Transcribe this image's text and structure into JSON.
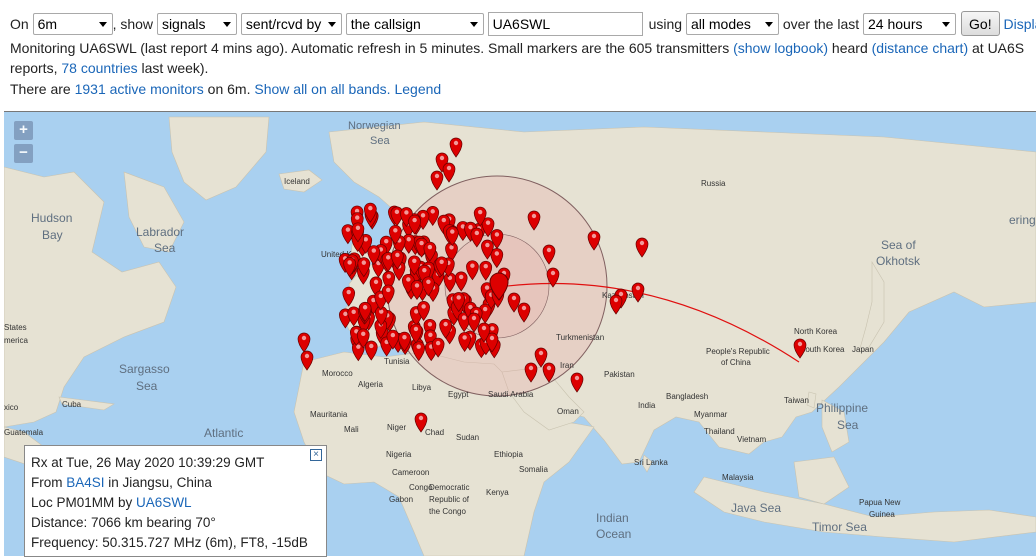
{
  "controls": {
    "on_label": "On",
    "band_value": "6m",
    "show_label": ", show",
    "show_value": "signals",
    "direction_value": "sent/rcvd by",
    "target_value": "the callsign",
    "callsign_value": "UA6SWL",
    "using_label": "using",
    "mode_value": "all modes",
    "over_label": "over the last",
    "period_value": "24 hours",
    "go_label": "Go!",
    "display_link": "Displa"
  },
  "info": {
    "line1_part1": "Monitoring UA6SWL (last report 4 mins ago). Automatic refresh in 5 minutes. Small markers are the 605 transmitters ",
    "show_logbook": "(show logbook)",
    "line1_part2": " heard ",
    "distance_chart": "(distance chart)",
    "line1_part3": " at UA6S",
    "line2_part1": "reports, ",
    "countries_link": "78 countries",
    "line2_part2": " last week).",
    "line3_part1": "There are ",
    "monitors_link": "1931 active monitors",
    "line3_part2": " on 6m. ",
    "show_all_link": "Show all on all bands.",
    "legend_link": "Legend"
  },
  "map": {
    "zoom_in": "+",
    "zoom_out": "−",
    "colors": {
      "sea": "#a9d0f0",
      "land": "#e6e2d3",
      "marker": "#dd0000",
      "circle": "#c06060",
      "path": "#e01010"
    },
    "sea_labels": {
      "norwegian_sea": "Norwegian",
      "norwegian_sea2": "Sea",
      "hudson_bay": "Hudson",
      "hudson_bay2": "Bay",
      "labrador": "Labrador",
      "labrador2": "Sea",
      "sargasso": "Sargasso",
      "sargasso2": "Sea",
      "atlantic": "Atlantic",
      "okhotsk": "Sea of",
      "okhotsk2": "Okhotsk",
      "philippine": "Philippine",
      "philippine2": "Sea",
      "java": "Java Sea",
      "timor": "Timor Sea",
      "indian": "Indian",
      "indian2": "Ocean",
      "bering": "ering"
    },
    "land_labels": {
      "iceland": "Iceland",
      "russia": "Russia",
      "united_kingdom": "United K",
      "states": "States",
      "america": "merica",
      "kazakhstan": "Kazakhstan",
      "turkmenistan": "Turkmenistan",
      "iran": "Iran",
      "pakistan": "Pakistan",
      "peoples_republic": "People's Republic",
      "of_china": "of China",
      "north_korea": "North Korea",
      "south_korea": "South Korea",
      "japan": "Japan",
      "taiwan": "Taiwan",
      "bangladesh": "Bangladesh",
      "myanmar": "Myanmar",
      "vietnam": "Vietnam",
      "thailand": "Thailand",
      "india": "India",
      "sri_lanka": "Sri Lanka",
      "malaysia": "Malaysia",
      "papua_new_guinea": "Papua New",
      "guinea": "Guinea",
      "oman": "Oman",
      "saudi_arabia": "Saudi Arabia",
      "egypt": "Egypt",
      "sudan": "Sudan",
      "chad": "Chad",
      "niger": "Niger",
      "mali": "Mali",
      "mauritania": "Mauritania",
      "algeria": "Algeria",
      "libya": "Libya",
      "tunisia": "Tunisia",
      "morocco": "Morocco",
      "nigeria": "Nigeria",
      "ethiopia": "Ethiopia",
      "somalia": "Somalia",
      "kenya": "Kenya",
      "cameroon": "Cameroon",
      "gabon": "Gabon",
      "congo": "Congo",
      "drc": "Democratic",
      "drc2": "Republic of",
      "drc3": "the Congo",
      "cuba": "Cuba",
      "mexico": "xico",
      "guatemala": "Guatemala"
    }
  },
  "popup": {
    "line1": "Rx at Tue, 26 May 2020 10:39:29 GMT",
    "from_label": "From ",
    "from_call": "BA4SI",
    "from_loc": " in Jiangsu, China",
    "loc_label": "Loc PM01MM by ",
    "loc_call": "UA6SWL",
    "distance": "Distance: 7066 km bearing 70°",
    "frequency": "Frequency: 50.315.727 MHz (6m), FT8, -15dB",
    "close": "×"
  }
}
